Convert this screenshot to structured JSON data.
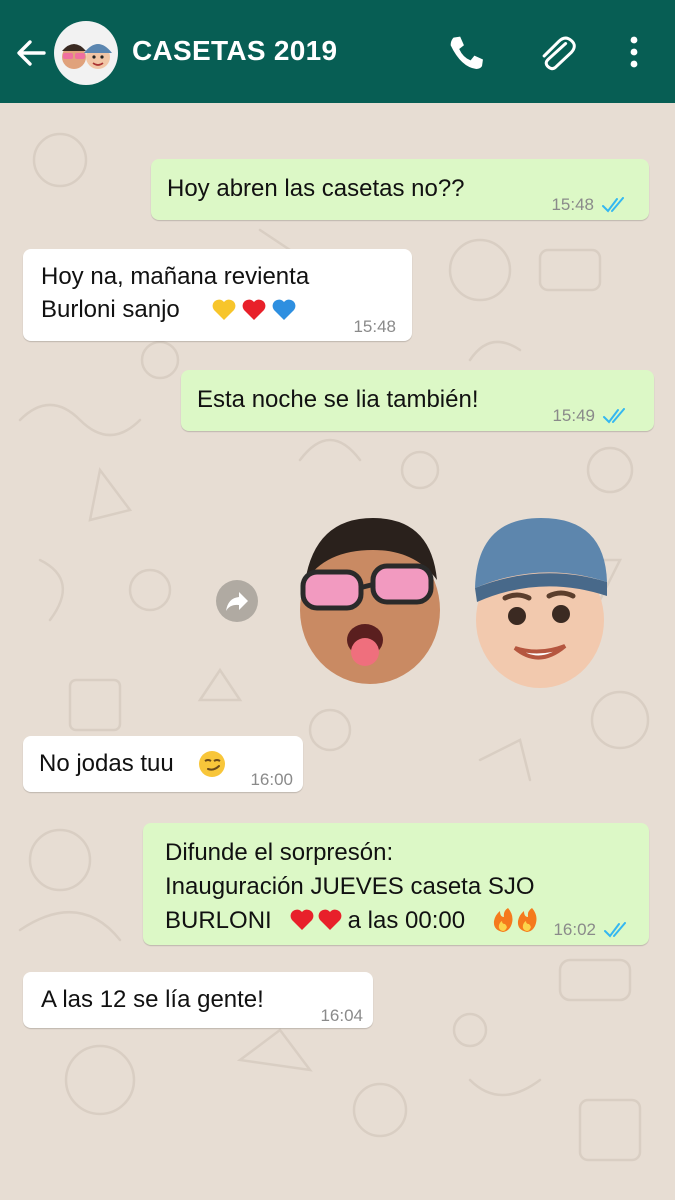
{
  "header": {
    "title": "CASETAS 2019",
    "color": "#075e54"
  },
  "messages": [
    {
      "dir": "out",
      "lines": [
        "Hoy abren las casetas no??"
      ],
      "time": "15:48",
      "read": true
    },
    {
      "dir": "in",
      "lines": [
        "Hoy na, mañana revienta",
        "Burloni sanjo"
      ],
      "emojis": [
        "yellow-heart",
        "red-heart",
        "blue-heart"
      ],
      "time": "15:48"
    },
    {
      "dir": "out",
      "lines": [
        "Esta noche se lia también!"
      ],
      "time": "15:49",
      "read": true
    },
    {
      "dir": "in",
      "type": "sticker",
      "description_icons": [
        "memoji-sunglasses-tongue",
        "memoji-cap-smile"
      ]
    },
    {
      "dir": "in",
      "lines": [
        "No jodas tuu"
      ],
      "emojis": [
        "smirk-face"
      ],
      "time": "16:00"
    },
    {
      "dir": "out",
      "lines": [
        "Difunde el sorpresón:",
        "Inauguración JUEVES caseta SJO",
        "BURLONI",
        " a las 00:00"
      ],
      "emojis": [
        "red-heart",
        "red-heart",
        "fire",
        "fire"
      ],
      "time": "16:02",
      "read": true
    },
    {
      "dir": "in",
      "lines": [
        "A las 12 se lía gente!"
      ],
      "time": "16:04"
    }
  ],
  "colors": {
    "outgoing_bubble": "#dcf8c6",
    "incoming_bubble": "#ffffff",
    "read_ticks": "#34b7f1",
    "wallpaper": "#e7ddd3"
  }
}
